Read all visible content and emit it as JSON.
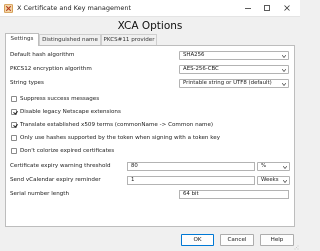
{
  "window": {
    "title": "X Certificate and Key management"
  },
  "dialog": {
    "heading": "XCA Options"
  },
  "tabs": [
    {
      "label": "Settings",
      "active": true
    },
    {
      "label": "Distinguished name",
      "active": false
    },
    {
      "label": "PKCS#11 provider",
      "active": false
    }
  ],
  "settings": {
    "hash_algorithm": {
      "label": "Default hash algorithm",
      "value": "SHA256"
    },
    "pkcs12_algorithm": {
      "label": "PKCS12 encryption algorithm",
      "value": "AES-256-CBC"
    },
    "string_types": {
      "label": "String types",
      "value": "Printable string or UTF8 (default)"
    },
    "checkboxes": [
      {
        "label": "Suppress success messages",
        "checked": false
      },
      {
        "label": "Disable legacy Netscape extensions",
        "checked": true
      },
      {
        "label": "Translate established x509 terms (commonName -> Common name)",
        "checked": true
      },
      {
        "label": "Only use hashes supported by the token when signing with a token key",
        "checked": false
      },
      {
        "label": "Don't colorize expired certificates",
        "checked": false
      }
    ],
    "expiry_warning": {
      "label": "Certificate expiry warning threshold",
      "value": "80",
      "unit": "%"
    },
    "vcalendar": {
      "label": "Send vCalendar expiry reminder",
      "value": "1",
      "unit": "Weeks"
    },
    "serial_length": {
      "label": "Serial number length",
      "value": "64 bit"
    }
  },
  "buttons": {
    "ok": "OK",
    "cancel": "Cancel",
    "help": "Help"
  }
}
